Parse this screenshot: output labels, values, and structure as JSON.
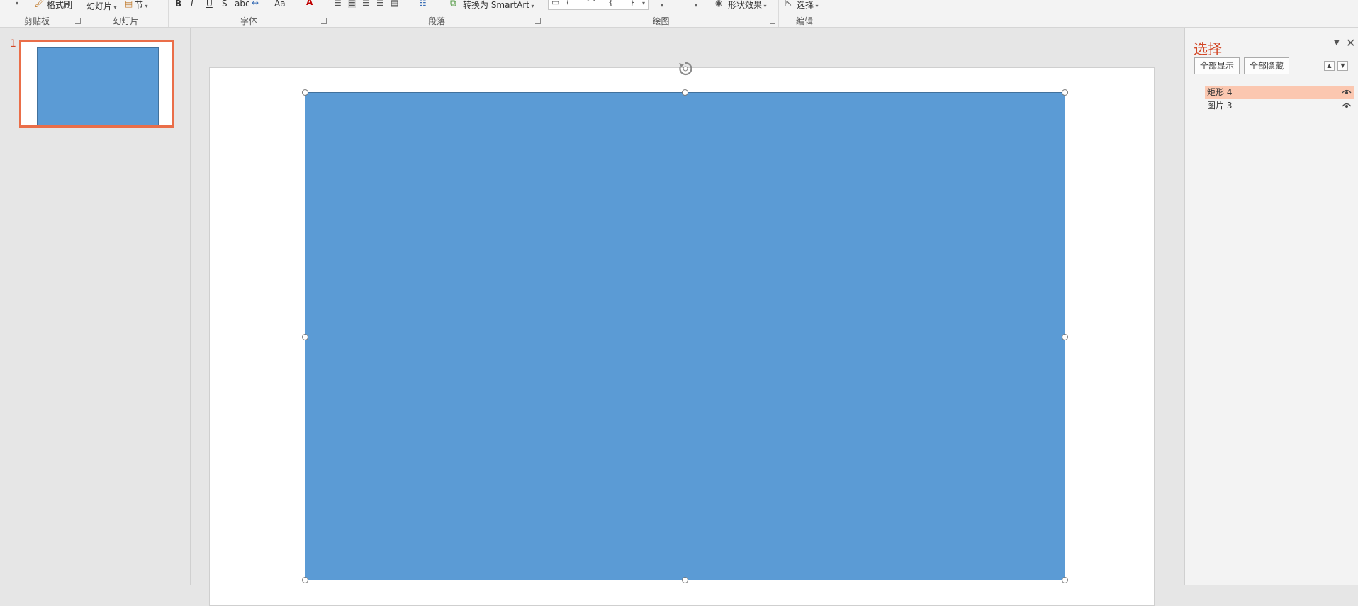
{
  "ribbon": {
    "clipboard": {
      "label": "剪贴板",
      "format_painter": "格式刷"
    },
    "slides": {
      "label": "幻灯片",
      "layout": "幻灯片",
      "section": "节"
    },
    "font": {
      "label": "字体",
      "bold": "B",
      "italic": "I",
      "underline": "U",
      "shadow": "S",
      "strike": "abc",
      "change_case": "Aa"
    },
    "paragraph": {
      "label": "段落",
      "convert_smartart": "转换为 SmartArt"
    },
    "drawing": {
      "label": "绘图",
      "shape_effects": "形状效果"
    },
    "editing": {
      "label": "编辑",
      "select": "选择"
    }
  },
  "thumbnails": {
    "slide_number": "1"
  },
  "selection_pane": {
    "title": "选择",
    "show_all": "全部显示",
    "hide_all": "全部隐藏",
    "items": [
      {
        "name": "矩形 4",
        "selected": true
      },
      {
        "name": "图片 3",
        "selected": false
      }
    ]
  },
  "colors": {
    "shape_fill": "#5b9bd5",
    "shape_outline": "#41719c",
    "accent": "#d24726",
    "thumb_border": "#ea6e49",
    "selected_item": "#fbc7b0"
  },
  "icons": [
    "format-painter-icon",
    "rotate-handle-icon",
    "eye-icon",
    "close-icon",
    "move-up-icon",
    "move-down-icon",
    "select-cursor-icon"
  ]
}
